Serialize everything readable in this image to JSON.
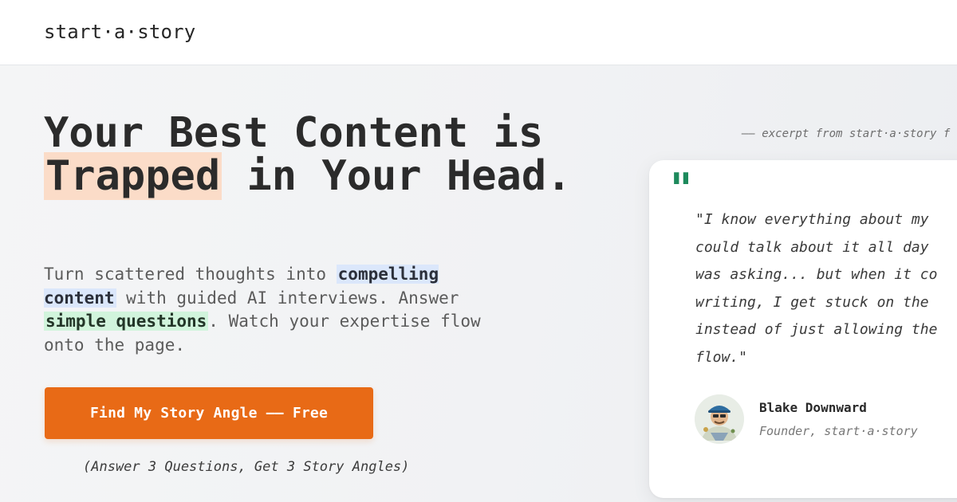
{
  "header": {
    "logo": "start·a·story"
  },
  "hero": {
    "headline_part1": "Your Best Content is ",
    "headline_highlight": "Trapped",
    "headline_part2": " in Your Head.",
    "sub_part1": "Turn scattered thoughts into ",
    "sub_highlight1": "compelling content",
    "sub_part2": " with guided AI interviews. Answer ",
    "sub_highlight2": "simple questions",
    "sub_part3": ". Watch your expertise flow onto the page.",
    "cta_label": "Find My Story Angle —— Free",
    "cta_note": "(Answer 3 Questions, Get 3 Story Angles)"
  },
  "testimonial": {
    "excerpt_label": "—— excerpt from start·a·story f",
    "quote_mark": "\"",
    "quote": "\"I know everything about my\ncould talk about it all day\nwas asking... but when it co\nwriting, I get stuck on the\ninstead of just allowing the\nflow.\"",
    "author_name": "Blake Downward",
    "author_role": "Founder, start·a·story",
    "avatar_icon": "person-avatar-icon"
  },
  "colors": {
    "accent": "#e86a16",
    "quote_green": "#1d8a5c",
    "highlight_peach": "#fbdcc8",
    "highlight_blue": "#dbe7fb",
    "highlight_green": "#d1f4dc"
  }
}
